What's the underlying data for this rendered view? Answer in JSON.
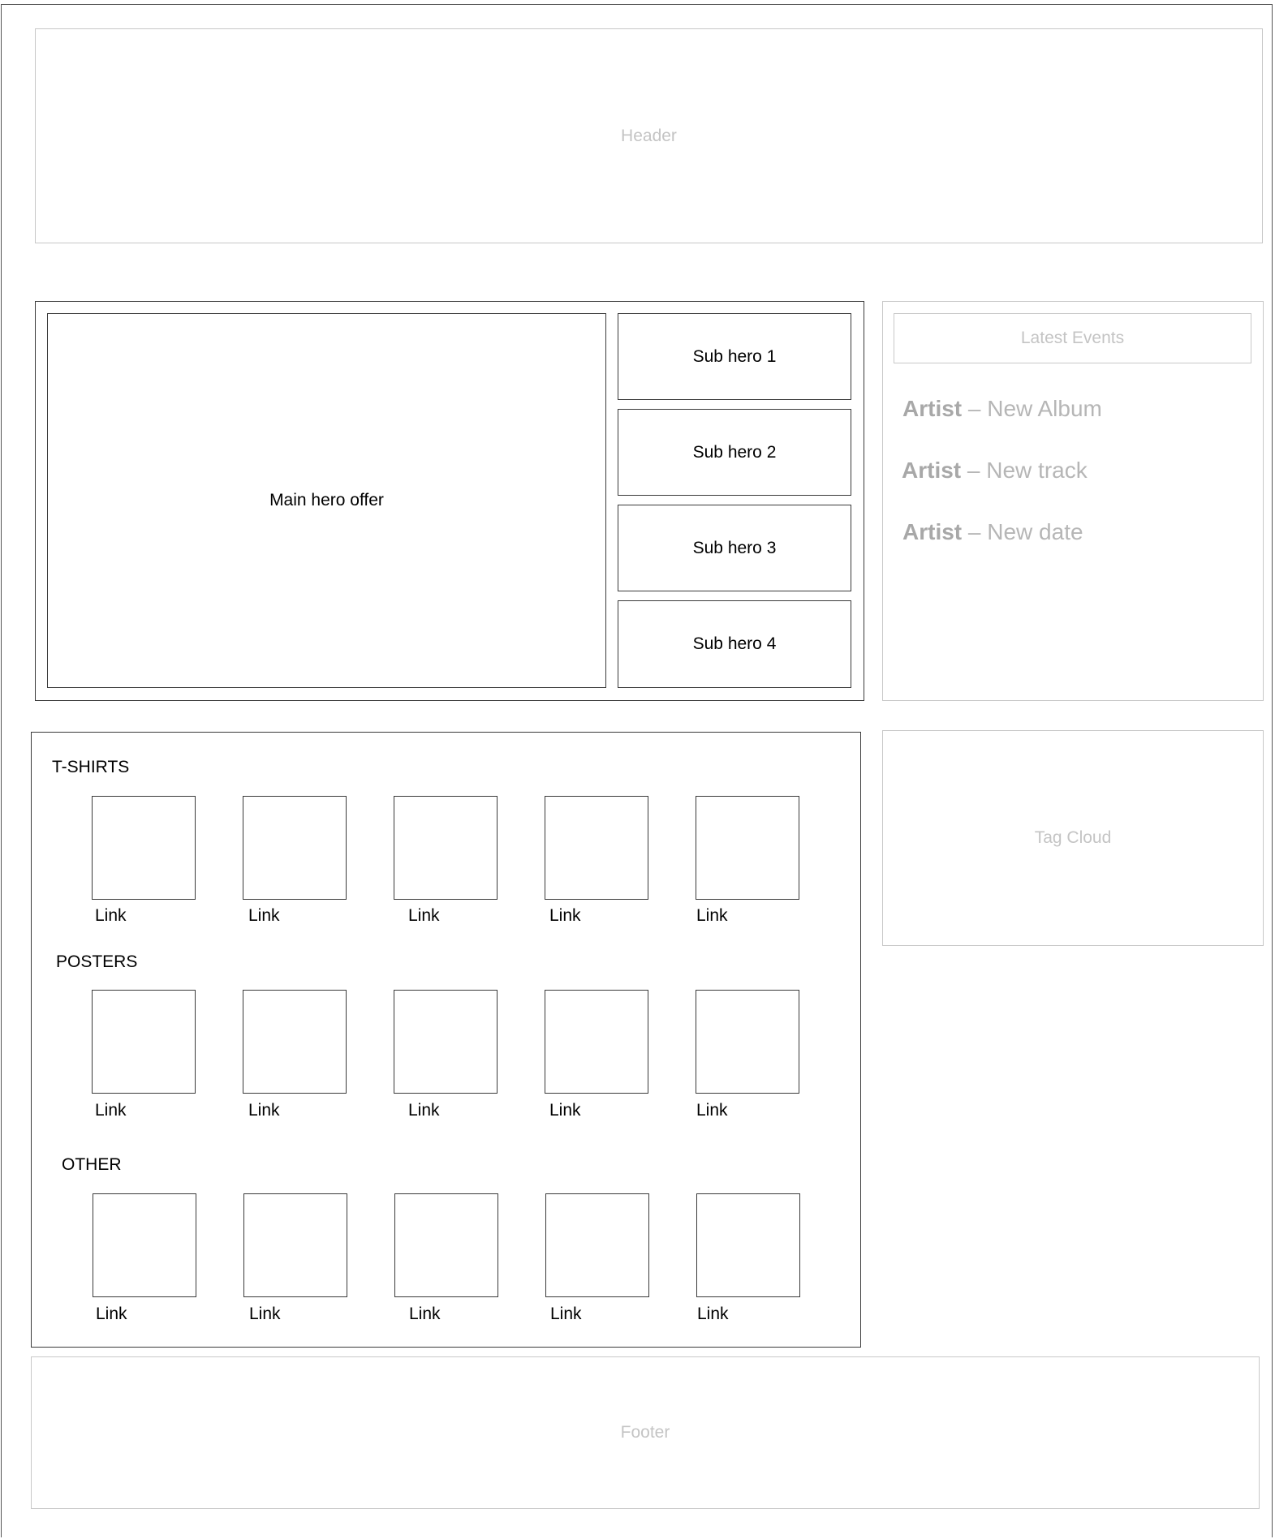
{
  "header": {
    "label": "Header"
  },
  "hero": {
    "main_label": "Main hero offer",
    "subs": [
      "Sub hero 1",
      "Sub hero 2",
      "Sub hero 3",
      "Sub hero 4"
    ]
  },
  "events": {
    "title": "Latest Events",
    "items": [
      {
        "artist": "Artist",
        "text": " – New Album"
      },
      {
        "artist": "Artist",
        "text": " – New track"
      },
      {
        "artist": "Artist",
        "text": " – New date"
      }
    ]
  },
  "tag_cloud": {
    "label": "Tag Cloud"
  },
  "products": {
    "sections": [
      {
        "title": "T-SHIRTS",
        "links": [
          "Link",
          "Link",
          "Link",
          "Link",
          "Link"
        ]
      },
      {
        "title": "POSTERS",
        "links": [
          "Link",
          "Link",
          "Link",
          "Link",
          "Link"
        ]
      },
      {
        "title": "OTHER",
        "links": [
          "Link",
          "Link",
          "Link",
          "Link",
          "Link"
        ]
      }
    ]
  },
  "footer": {
    "label": "Footer"
  },
  "colors": {
    "light_border": "#c8c8c8",
    "dark_border": "#3a3a3a",
    "muted_text": "#b6b6b6"
  }
}
